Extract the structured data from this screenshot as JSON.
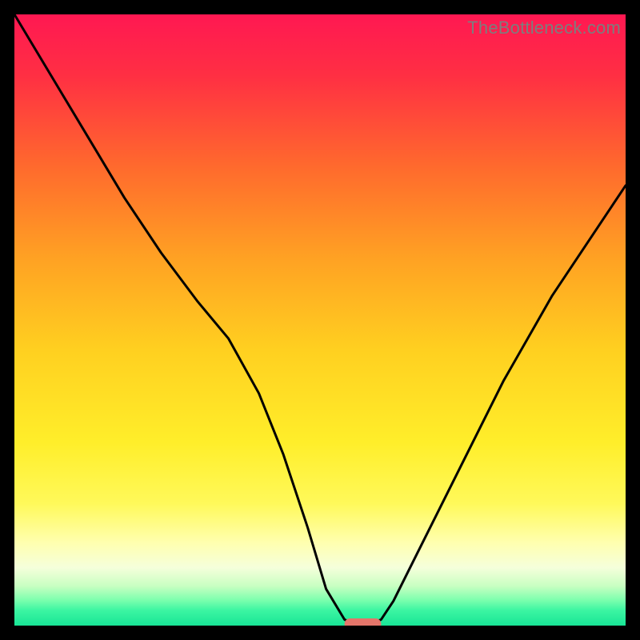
{
  "watermark": "TheBottleneck.com",
  "colors": {
    "frame": "#000000",
    "curve": "#000000",
    "marker": "#e4756a",
    "gradient_stops": [
      {
        "offset": 0.0,
        "color": "#ff1852"
      },
      {
        "offset": 0.1,
        "color": "#ff2f43"
      },
      {
        "offset": 0.25,
        "color": "#ff6a2d"
      },
      {
        "offset": 0.4,
        "color": "#ffa223"
      },
      {
        "offset": 0.55,
        "color": "#ffd020"
      },
      {
        "offset": 0.7,
        "color": "#ffee2a"
      },
      {
        "offset": 0.8,
        "color": "#fff95a"
      },
      {
        "offset": 0.865,
        "color": "#ffffb0"
      },
      {
        "offset": 0.905,
        "color": "#f5ffdb"
      },
      {
        "offset": 0.935,
        "color": "#c9ffc2"
      },
      {
        "offset": 0.958,
        "color": "#7dffae"
      },
      {
        "offset": 0.975,
        "color": "#3cf5a2"
      },
      {
        "offset": 1.0,
        "color": "#18e596"
      }
    ]
  },
  "chart_data": {
    "type": "line",
    "title": "",
    "xlabel": "",
    "ylabel": "",
    "xlim": [
      0,
      100
    ],
    "ylim": [
      0,
      100
    ],
    "legend": false,
    "grid": false,
    "series": [
      {
        "name": "bottleneck-curve",
        "x": [
          0,
          6,
          12,
          18,
          24,
          30,
          35,
          40,
          44,
          48,
          51,
          54,
          56,
          58,
          60,
          62,
          66,
          72,
          80,
          88,
          96,
          100
        ],
        "y": [
          100,
          90,
          80,
          70,
          61,
          53,
          47,
          38,
          28,
          16,
          6,
          1,
          0,
          0,
          1,
          4,
          12,
          24,
          40,
          54,
          66,
          72
        ]
      }
    ],
    "marker": {
      "x_start": 54,
      "x_end": 60,
      "y": 0
    },
    "annotations": []
  }
}
